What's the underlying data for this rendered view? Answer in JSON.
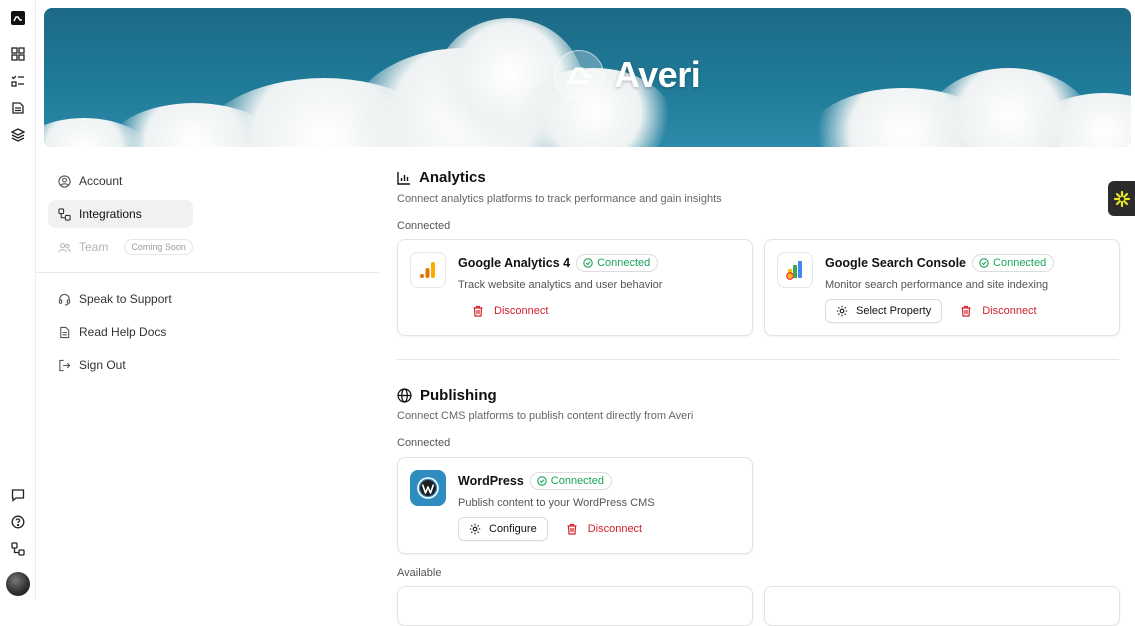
{
  "brand": {
    "name": "Averi"
  },
  "sidebar": {
    "account": "Account",
    "integrations": "Integrations",
    "team": "Team",
    "team_badge": "Coming Soon",
    "support": "Speak to Support",
    "help": "Read Help Docs",
    "signout": "Sign Out"
  },
  "analytics": {
    "title": "Analytics",
    "desc": "Connect analytics platforms to track performance and gain insights",
    "connected_label": "Connected",
    "cards": [
      {
        "title": "Google Analytics 4",
        "status": "Connected",
        "desc": "Track website analytics and user behavior",
        "disconnect": "Disconnect"
      },
      {
        "title": "Google Search Console",
        "status": "Connected",
        "desc": "Monitor search performance and site indexing",
        "select": "Select Property",
        "disconnect": "Disconnect"
      }
    ]
  },
  "publishing": {
    "title": "Publishing",
    "desc": "Connect CMS platforms to publish content directly from Averi",
    "connected_label": "Connected",
    "available_label": "Available",
    "cards": [
      {
        "title": "WordPress",
        "status": "Connected",
        "desc": "Publish content to your WordPress CMS",
        "configure": "Configure",
        "disconnect": "Disconnect"
      }
    ]
  },
  "colors": {
    "connected": "#19a35b",
    "danger": "#d4212a",
    "hero": "#1f7a98"
  }
}
